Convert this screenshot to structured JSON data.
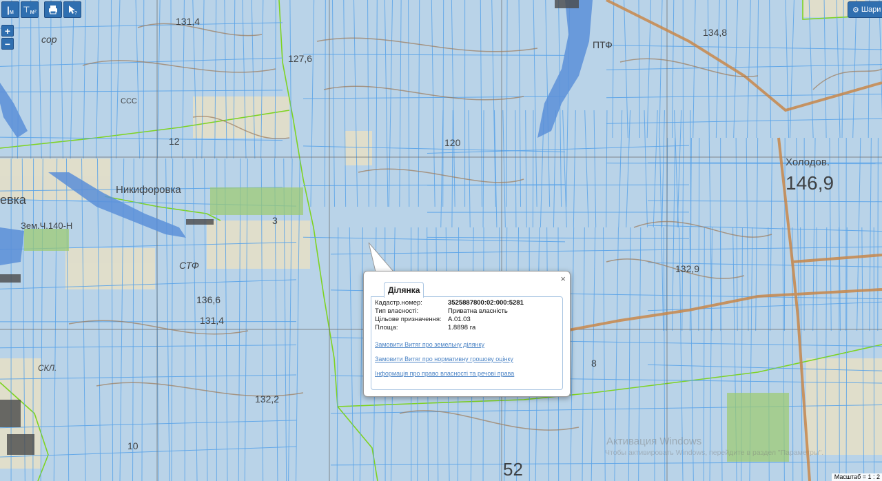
{
  "toolbar": {
    "measure_length": "м",
    "measure_area": "м²",
    "layers_label": "Шари"
  },
  "zoom": {
    "in": "+",
    "out": "−"
  },
  "map_labels": [
    {
      "text": "131,4"
    },
    {
      "text": "сор"
    },
    {
      "text": "127,6"
    },
    {
      "text": "ПТФ"
    },
    {
      "text": "134,8"
    },
    {
      "text": "ССС"
    },
    {
      "text": "12"
    },
    {
      "text": "120"
    },
    {
      "text": "Никифоровка"
    },
    {
      "text": "евка"
    },
    {
      "text": "Зем.Ч.140-Н"
    },
    {
      "text": "СТФ"
    },
    {
      "text": "136,6"
    },
    {
      "text": "131,4"
    },
    {
      "text": "СКЛ."
    },
    {
      "text": "132,2"
    },
    {
      "text": "10"
    },
    {
      "text": "52"
    },
    {
      "text": "132,9"
    },
    {
      "text": "146,9"
    },
    {
      "text": "Холодов."
    },
    {
      "text": "8"
    },
    {
      "text": "3"
    }
  ],
  "popup": {
    "tab_label": "Ділянка",
    "close": "×",
    "rows": [
      {
        "label": "Кадастр.номер:",
        "value": "3525887800:02:000:5281"
      },
      {
        "label": "Тип власності:",
        "value": "Приватна власність"
      },
      {
        "label": "Цільове призначення:",
        "value": "A.01.03"
      },
      {
        "label": "Площа:",
        "value": "1.8898 га"
      }
    ],
    "links": [
      "Замовити Витяг про земельну ділянку",
      "Замовити Витяг про нормативну грошову оцінку",
      "Інформація про право власності та речові права"
    ]
  },
  "watermark": {
    "title": "Активация Windows",
    "subtitle": "Чтобы активировать Windows, перейдите в раздел \"Параметры\"."
  },
  "scale_label": "Масштаб = 1 : 2",
  "colors": {
    "parcel_fill": "#b5d3ec",
    "parcel_stroke": "#5aa3e8",
    "boundary_green": "#7ed321",
    "water": "#5b8fd8",
    "road": "#c8874a",
    "button_blue": "#2f6fb0"
  }
}
